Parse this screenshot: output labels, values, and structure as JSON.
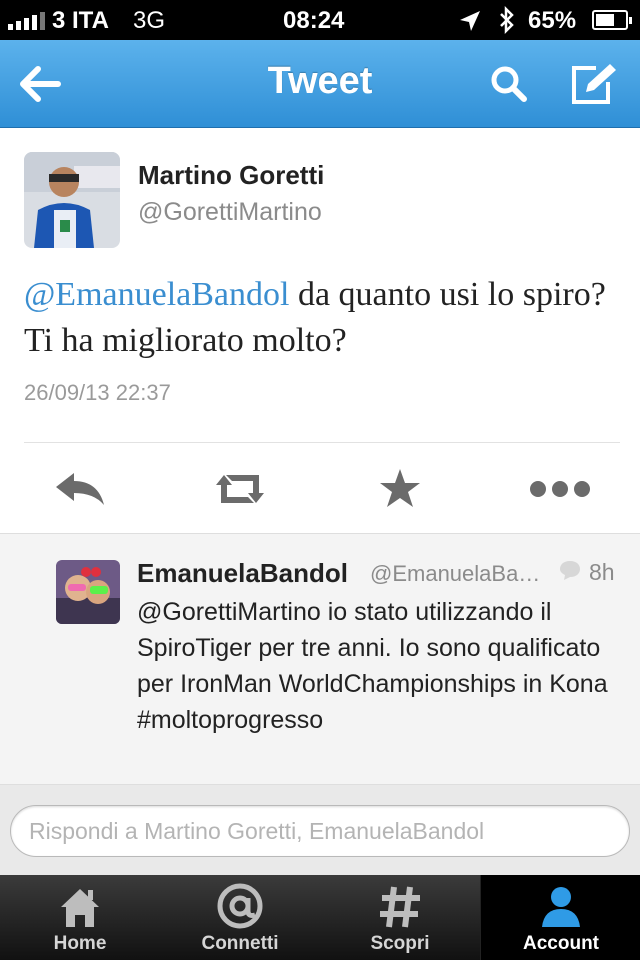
{
  "status_bar": {
    "carrier": "3 ITA",
    "network": "3G",
    "time": "08:24",
    "battery": "65%",
    "battery_level": 0.65
  },
  "nav": {
    "title": "Tweet",
    "back_icon": "back-arrow-icon",
    "search_icon": "search-icon",
    "compose_icon": "compose-icon"
  },
  "tweet": {
    "author_name": "Martino Goretti",
    "author_handle": "@GorettiMartino",
    "mention": "@EmanuelaBandol",
    "text": " da quanto usi lo spiro? Ti ha migliorato molto?",
    "timestamp": "26/09/13 22:37",
    "actions": [
      "reply-icon",
      "retweet-icon",
      "favorite-star-icon",
      "more-icon"
    ]
  },
  "reply": {
    "author_name": "EmanuelaBandol",
    "author_handle": "@EmanuelaBa…",
    "age": "8h",
    "text": "@GorettiMartino io stato utilizzando il SpiroTiger per tre anni. Io sono qualificato per IronMan WorldChampionships in Kona #moltoprogresso"
  },
  "compose": {
    "placeholder": "Rispondi a Martino Goretti, EmanuelaBandol",
    "value": ""
  },
  "tab_bar": {
    "tabs": [
      {
        "label": "Home",
        "icon": "home-icon"
      },
      {
        "label": "Connetti",
        "icon": "at-sign-icon"
      },
      {
        "label": "Scopri",
        "icon": "hashtag-icon"
      },
      {
        "label": "Account",
        "icon": "person-icon"
      }
    ],
    "active": "Account"
  },
  "colors": {
    "nav_blue": "#2f8fd6",
    "link_blue": "#3a8ed0",
    "tab_active_icon": "#2f9be6"
  }
}
